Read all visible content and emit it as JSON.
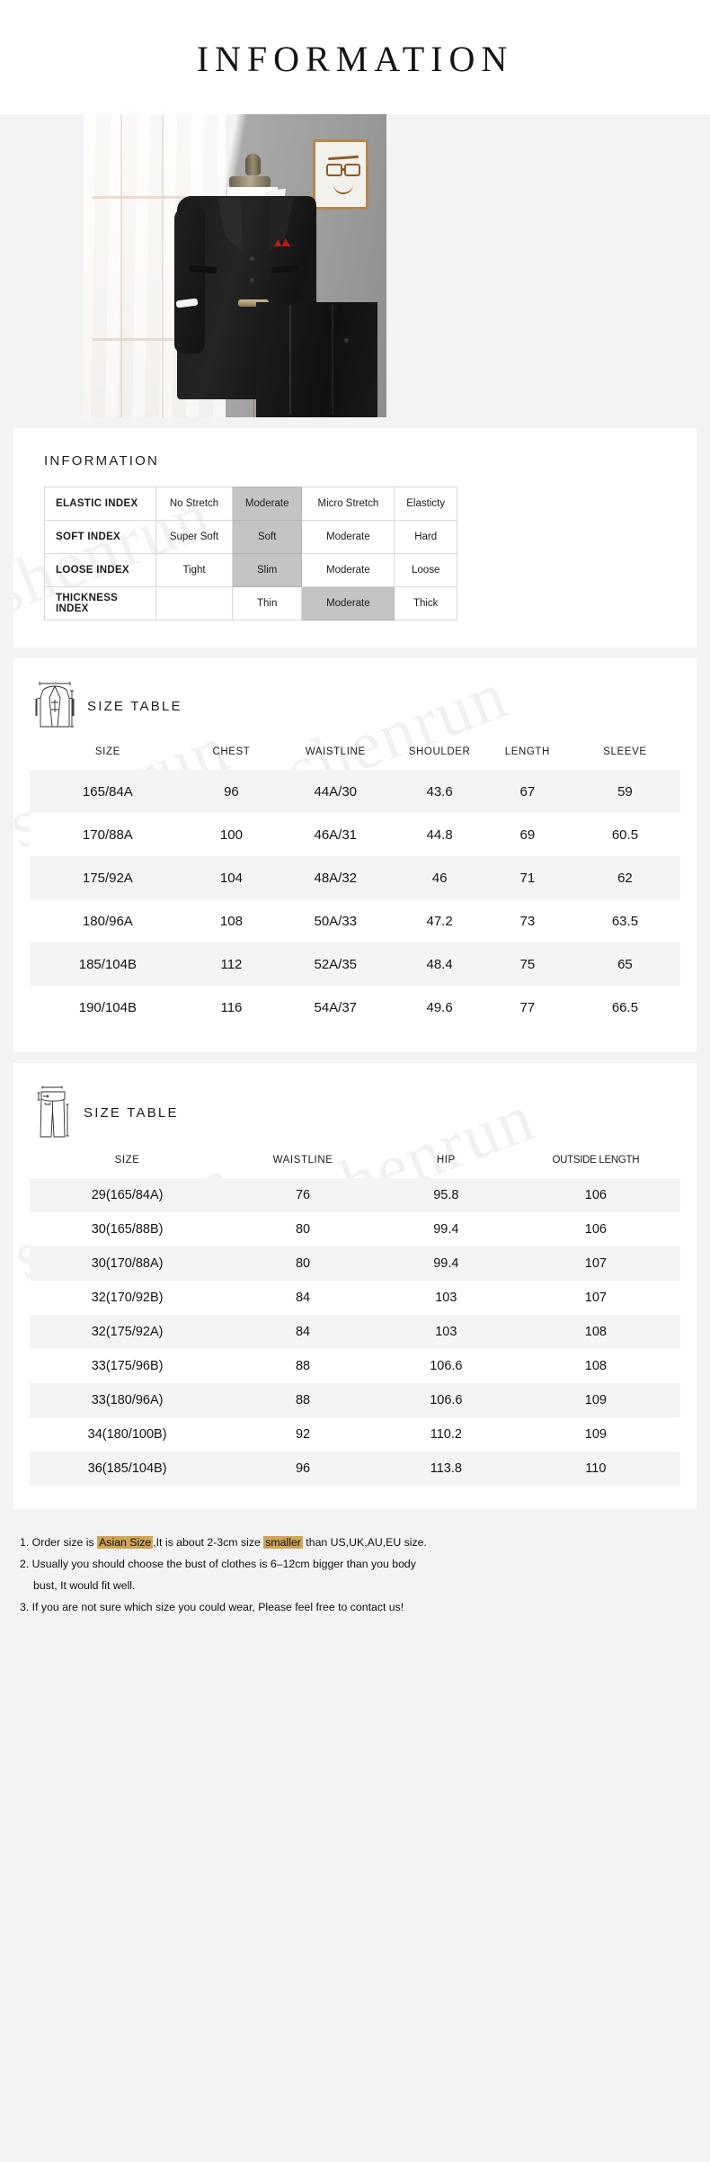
{
  "header": {
    "title": "INFORMATION"
  },
  "hero": {
    "alt": "black two-piece suit on mannequin"
  },
  "information_section": {
    "heading": "INFORMATION",
    "rows": [
      {
        "label": "ELASTIC  INDEX",
        "cells": [
          "No Stretch",
          "Moderate",
          "Micro Stretch",
          "Elasticty"
        ],
        "highlight_index": 1
      },
      {
        "label": "SOFT  INDEX",
        "cells": [
          "Super Soft",
          "Soft",
          "Moderate",
          "Hard"
        ],
        "highlight_index": 1
      },
      {
        "label": "LOOSE  INDEX",
        "cells": [
          "Tight",
          "Slim",
          "Moderate",
          "Loose"
        ],
        "highlight_index": 1
      },
      {
        "label": "THICKNESS INDEX",
        "cells": [
          "",
          "Thin",
          "Moderate",
          "Thick"
        ],
        "highlight_index": 2
      }
    ]
  },
  "jacket_table": {
    "heading": "SIZE TABLE",
    "icon": "jacket-diagram-icon",
    "columns": [
      "SIZE",
      "CHEST",
      "WAISTLINE",
      "SHOULDER",
      "LENGTH",
      "SLEEVE"
    ],
    "rows": [
      [
        "165/84A",
        "96",
        "44A/30",
        "43.6",
        "67",
        "59"
      ],
      [
        "170/88A",
        "100",
        "46A/31",
        "44.8",
        "69",
        "60.5"
      ],
      [
        "175/92A",
        "104",
        "48A/32",
        "46",
        "71",
        "62"
      ],
      [
        "180/96A",
        "108",
        "50A/33",
        "47.2",
        "73",
        "63.5"
      ],
      [
        "185/104B",
        "112",
        "52A/35",
        "48.4",
        "75",
        "65"
      ],
      [
        "190/104B",
        "116",
        "54A/37",
        "49.6",
        "77",
        "66.5"
      ]
    ]
  },
  "pants_table": {
    "heading": "SIZE TABLE",
    "icon": "trousers-diagram-icon",
    "columns": [
      "SIZE",
      "WAISTLINE",
      "HIP",
      "OUTSIDE LENGTH"
    ],
    "rows": [
      [
        "29(165/84A)",
        "76",
        "95.8",
        "106"
      ],
      [
        "30(165/88B)",
        "80",
        "99.4",
        "106"
      ],
      [
        "30(170/88A)",
        "80",
        "99.4",
        "107"
      ],
      [
        "32(170/92B)",
        "84",
        "103",
        "107"
      ],
      [
        "32(175/92A)",
        "84",
        "103",
        "108"
      ],
      [
        "33(175/96B)",
        "88",
        "106.6",
        "108"
      ],
      [
        "33(180/96A)",
        "88",
        "106.6",
        "109"
      ],
      [
        "34(180/100B)",
        "92",
        "110.2",
        "109"
      ],
      [
        "36(185/104B)",
        "96",
        "113.8",
        "110"
      ]
    ]
  },
  "notes": {
    "note1_part1": "1. Order  size  is ",
    "note1_hl1": "Asian Size",
    "note1_part2": ",It is about 2-3cm size ",
    "note1_hl2": "smaller",
    "note1_part3": " than US,UK,AU,EU size.",
    "note2_line1": "2. Usually  you  should  choose  the  bust  of  clothes  is  6–12cm  bigger  than  you  body",
    "note2_line2": "bust, It would fit well.",
    "note3": "3. If  you  are  not  sure  which  size  you  could  wear, Please feel free to contact us!"
  },
  "watermark": {
    "text": "shenrun"
  },
  "colors": {
    "page_background": "#f2f3f5",
    "card_background": "#ffffff",
    "highlight_cell": "#c4c4c4",
    "row_stripe": "#f4f4f4",
    "note_highlight": "#cfa457",
    "text": "#131313"
  }
}
